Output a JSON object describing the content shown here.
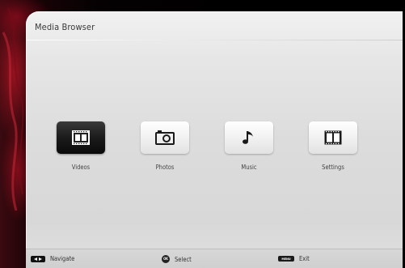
{
  "header": {
    "title": "Media Browser"
  },
  "tiles": [
    {
      "label": "Videos",
      "icon": "film-icon",
      "selected": true
    },
    {
      "label": "Photos",
      "icon": "camera-icon",
      "selected": false
    },
    {
      "label": "Music",
      "icon": "music-note-icon",
      "selected": false
    },
    {
      "label": "Settings",
      "icon": "film-settings-icon",
      "selected": false
    }
  ],
  "footer": {
    "navigate": {
      "key": "left-right-arrow-icon",
      "label": "Navigate"
    },
    "select": {
      "key": "ok-button-icon",
      "key_text": "OK",
      "label": "Select"
    },
    "exit": {
      "key": "menu-button-icon",
      "key_text": "MENU",
      "label": "Exit"
    }
  },
  "colors": {
    "panel": "#e2e2e2",
    "selected_tile": "#1b1b1b",
    "backdrop_accent": "#aa1423"
  }
}
